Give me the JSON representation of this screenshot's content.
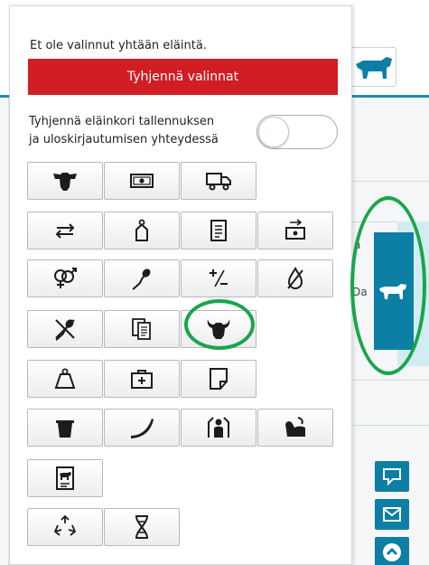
{
  "popup": {
    "message": "Et ole valinnut yhtään eläintä.",
    "clear_button": "Tyhjennä valinnat",
    "toggle_label_line1": "Tyhjennä eläinkori tallennuksen",
    "toggle_label_line2": "ja uloskirjautumisen yhteydessä",
    "toggle_on": false
  },
  "background": {
    "side_text_a": "a",
    "side_text_b": "Da"
  },
  "colors": {
    "danger": "#d11d24",
    "accent": "#0d7fa4",
    "highlight_ring": "#19a54a"
  },
  "icons": [
    [
      "cow-head-icon",
      "cash-icon",
      "truck-icon"
    ],
    [
      "transfer-arrows-icon",
      "ear-tag-icon",
      "document-list-icon",
      "money-exchange-icon"
    ],
    [
      "gender-symbols-icon",
      "insemination-icon",
      "plus-minus-icon",
      "dry-drop-icon"
    ],
    [
      "no-insemination-icon",
      "copy-documents-icon",
      "bull-head-icon"
    ],
    [
      "weight-icon",
      "first-aid-kit-icon",
      "note-icon"
    ],
    [
      "milk-bucket-icon",
      "horn-icon",
      "calving-icon",
      "feeding-icon"
    ],
    [
      "animal-report-icon"
    ],
    [
      "recycle-icon",
      "dna-icon"
    ]
  ]
}
